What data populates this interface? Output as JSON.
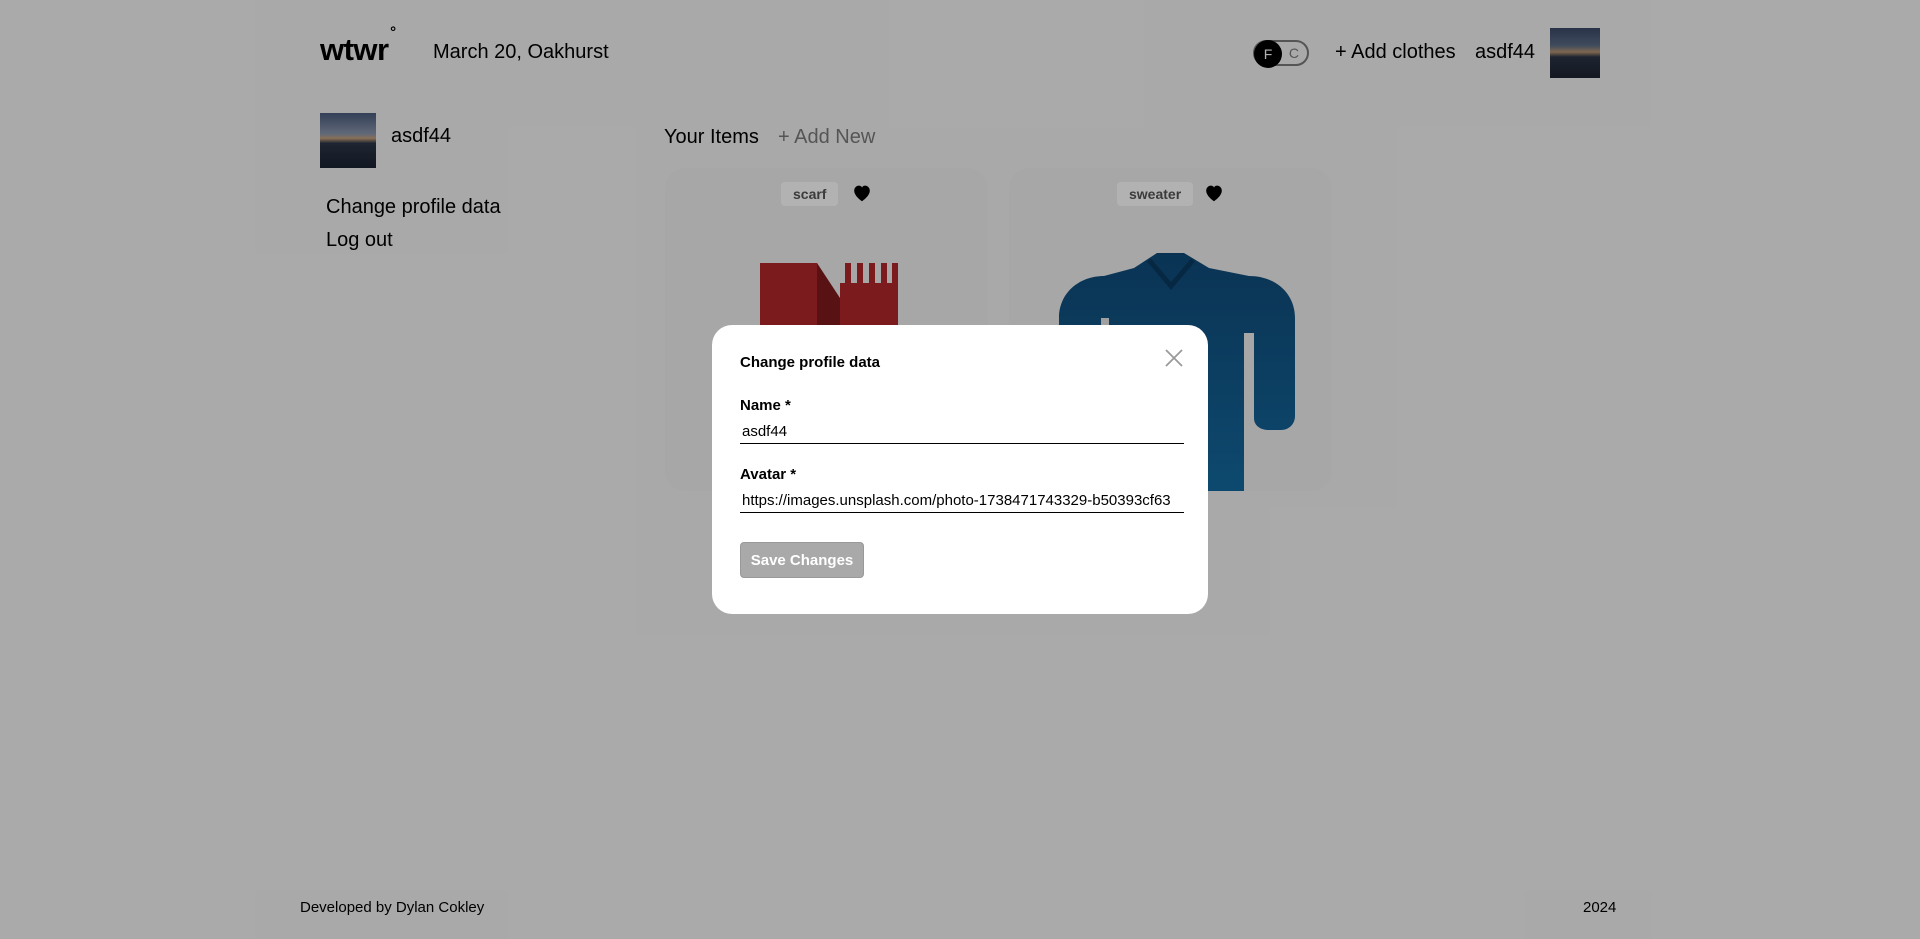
{
  "header": {
    "logo_text": "wtwr",
    "logo_mark": "°",
    "date_location": "March 20, Oakhurst",
    "toggle": {
      "left": "F",
      "right": "C",
      "active": "F"
    },
    "add_clothes": "+ Add clothes",
    "username": "asdf44"
  },
  "sidebar": {
    "username": "asdf44",
    "change_profile": "Change profile data",
    "logout": "Log out"
  },
  "items": {
    "heading": "Your Items",
    "add_new": "+ Add New",
    "cards": [
      {
        "name": "scarf",
        "icon": "scarf-image",
        "color": "#b0282a"
      },
      {
        "name": "sweater",
        "icon": "sweater-image",
        "color": "#146aa0"
      }
    ]
  },
  "modal": {
    "title": "Change profile data",
    "name_label": "Name *",
    "name_value": "asdf44",
    "avatar_label": "Avatar *",
    "avatar_value": "https://images.unsplash.com/photo-1738471743329-b50393cf63",
    "save_label": "Save Changes"
  },
  "footer": {
    "credit": "Developed by Dylan Cokley",
    "year": "2024"
  },
  "colors": {
    "overlay": "rgba(0,0,0,0.30)",
    "scarf": "#b0282a",
    "sweater": "#146aa0",
    "disabled_button": "#a9a9a9"
  }
}
